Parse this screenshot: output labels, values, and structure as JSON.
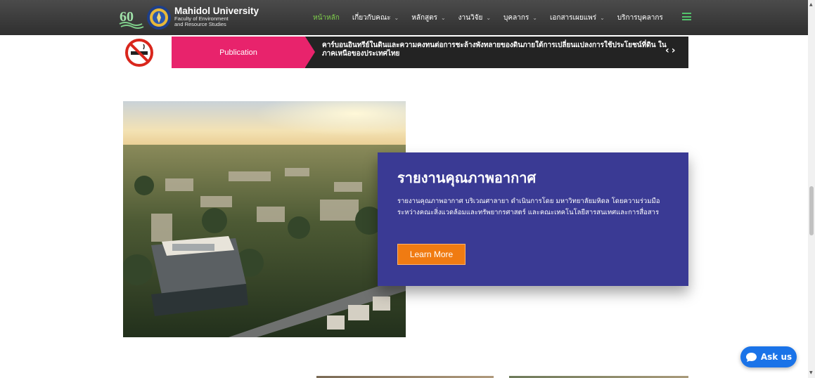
{
  "header": {
    "logo_title": "Mahidol University",
    "logo_sub1": "Faculty of Environment",
    "logo_sub2": "and Resource Studies",
    "logo_badge_text": "60",
    "menu": [
      {
        "label": "หน้าหลัก",
        "active": true,
        "has_dropdown": false
      },
      {
        "label": "เกี่ยวกับคณะ",
        "active": false,
        "has_dropdown": true
      },
      {
        "label": "หลักสูตร",
        "active": false,
        "has_dropdown": true
      },
      {
        "label": "งานวิจัย",
        "active": false,
        "has_dropdown": true
      },
      {
        "label": "บุคลากร",
        "active": false,
        "has_dropdown": true
      },
      {
        "label": "เอกสารเผยแพร่",
        "active": false,
        "has_dropdown": true
      },
      {
        "label": "บริการบุคลากร",
        "active": false,
        "has_dropdown": false
      }
    ],
    "dropdown_icon": "chevron-down-icon",
    "menu_icon": "hamburger-menu-icon",
    "active_color": "#7fcf4c"
  },
  "ticker": {
    "tag": "Publication",
    "text": "คาร์บอนอินทรีย์ในดินและความคงทนต่อการชะล้างพังทลายของดินภายใต้การเปลี่ยนแปลงการใช้ประโยชน์ที่ดิน ในภาคเหนือของประเทศไทย",
    "prev_icon": "chevron-left-icon",
    "next_icon": "chevron-right-icon",
    "tag_color": "#e8236c"
  },
  "feature": {
    "title": "รายงานคุณภาพอากาศ",
    "description": "รายงานคุณภาพอากาศ บริเวณศาลายา ดำเนินการโดย มหาวิทยาลัยมหิดล โดยความร่วมมือระหว่างคณะสิ่งแวดล้อมและทรัพยากรศาสตร์ และคณะเทคโนโลยีสารสนเทศและการสื่อสาร",
    "button_label": "Learn More",
    "card_color": "#3a3a94",
    "button_color": "#f07b12"
  },
  "chat": {
    "label": "Ask us",
    "icon": "chat-bubble-icon",
    "color": "#1a73e8"
  }
}
